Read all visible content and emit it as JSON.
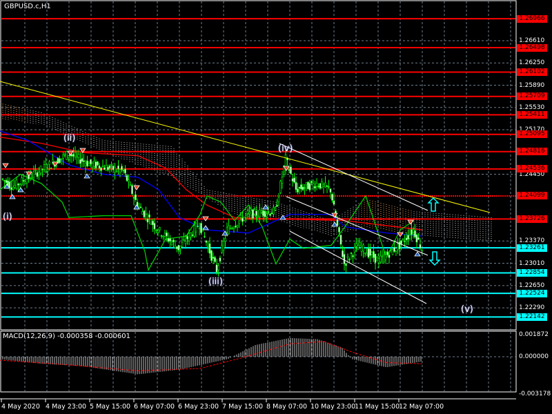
{
  "window": {
    "symbol_title": "GBPUSD.c,H1"
  },
  "colors": {
    "background": "#000000",
    "resistance": "#ff0000",
    "support": "#00ffff",
    "bull": "#00ff00",
    "trendline": "#ffff00",
    "kijun": "#0000ff",
    "chikou": "#00cc00"
  },
  "price_scale": {
    "ticks": [
      "1.26610",
      "1.26250",
      "1.25890",
      "1.25530",
      "1.25170",
      "1.24450",
      "1.23370",
      "1.23010",
      "1.22650",
      "1.22290"
    ],
    "tick_values": [
      1.2661,
      1.2625,
      1.2589,
      1.2553,
      1.2517,
      1.2445,
      1.2337,
      1.2301,
      1.2265,
      1.2229
    ]
  },
  "resistance_levels": [
    "1.26966",
    "1.26498",
    "1.26102",
    "1.25709",
    "1.25411",
    "1.25095",
    "1.24816",
    "1.24536",
    "1.24099",
    "1.23726"
  ],
  "support_levels": [
    "1.23261",
    "1.22854",
    "1.22524",
    "1.22142"
  ],
  "wave_labels": [
    "(i)",
    "(ii)",
    "(iii)",
    "(iv)",
    "(v)"
  ],
  "macd": {
    "title": "MACD(12,26,9) -0.000358 -0.000601",
    "scale": [
      "0.001872",
      "0.000000",
      "-0.003178"
    ],
    "scale_values": [
      0.001872,
      0,
      -0.003178
    ]
  },
  "time_axis": [
    "4 May 2020",
    "4 May 23:00",
    "5 May 15:00",
    "6 May 07:00",
    "6 May 23:00",
    "7 May 15:00",
    "8 May 07:00",
    "10 May 23:00",
    "11 May 15:00",
    "12 May 07:00"
  ],
  "chart_data": {
    "type": "candlestick",
    "title": "GBPUSD.c,H1",
    "ylim": [
      1.219,
      1.27
    ],
    "price_path": [
      [
        0,
        1.244
      ],
      [
        20,
        1.2425
      ],
      [
        50,
        1.2445
      ],
      [
        100,
        1.2478
      ],
      [
        130,
        1.2462
      ],
      [
        180,
        1.245
      ],
      [
        200,
        1.2395
      ],
      [
        230,
        1.2355
      ],
      [
        260,
        1.2325
      ],
      [
        290,
        1.2365
      ],
      [
        315,
        1.229
      ],
      [
        330,
        1.2355
      ],
      [
        360,
        1.238
      ],
      [
        400,
        1.2385
      ],
      [
        415,
        1.247
      ],
      [
        430,
        1.242
      ],
      [
        460,
        1.243
      ],
      [
        480,
        1.242
      ],
      [
        500,
        1.23
      ],
      [
        520,
        1.233
      ],
      [
        550,
        1.2305
      ],
      [
        580,
        1.233
      ],
      [
        600,
        1.2355
      ],
      [
        612,
        1.2325
      ]
    ],
    "macd_hist_path": [
      [
        0,
        -0.0002
      ],
      [
        60,
        -0.0006
      ],
      [
        120,
        -0.0008
      ],
      [
        200,
        -0.0015
      ],
      [
        260,
        -0.0011
      ],
      [
        330,
        -0.0002
      ],
      [
        370,
        0.001
      ],
      [
        420,
        0.0016
      ],
      [
        460,
        0.0015
      ],
      [
        495,
        0.0008
      ],
      [
        510,
        -0.0002
      ],
      [
        560,
        -0.0009
      ],
      [
        612,
        -0.0004
      ]
    ],
    "macd_signal_path": [
      [
        0,
        -0.0003
      ],
      [
        80,
        -0.0006
      ],
      [
        200,
        -0.0012
      ],
      [
        290,
        -0.001
      ],
      [
        350,
        -0.0001
      ],
      [
        420,
        0.0011
      ],
      [
        470,
        0.0013
      ],
      [
        510,
        0.0004
      ],
      [
        560,
        -0.0005
      ],
      [
        612,
        -0.0006
      ]
    ]
  }
}
